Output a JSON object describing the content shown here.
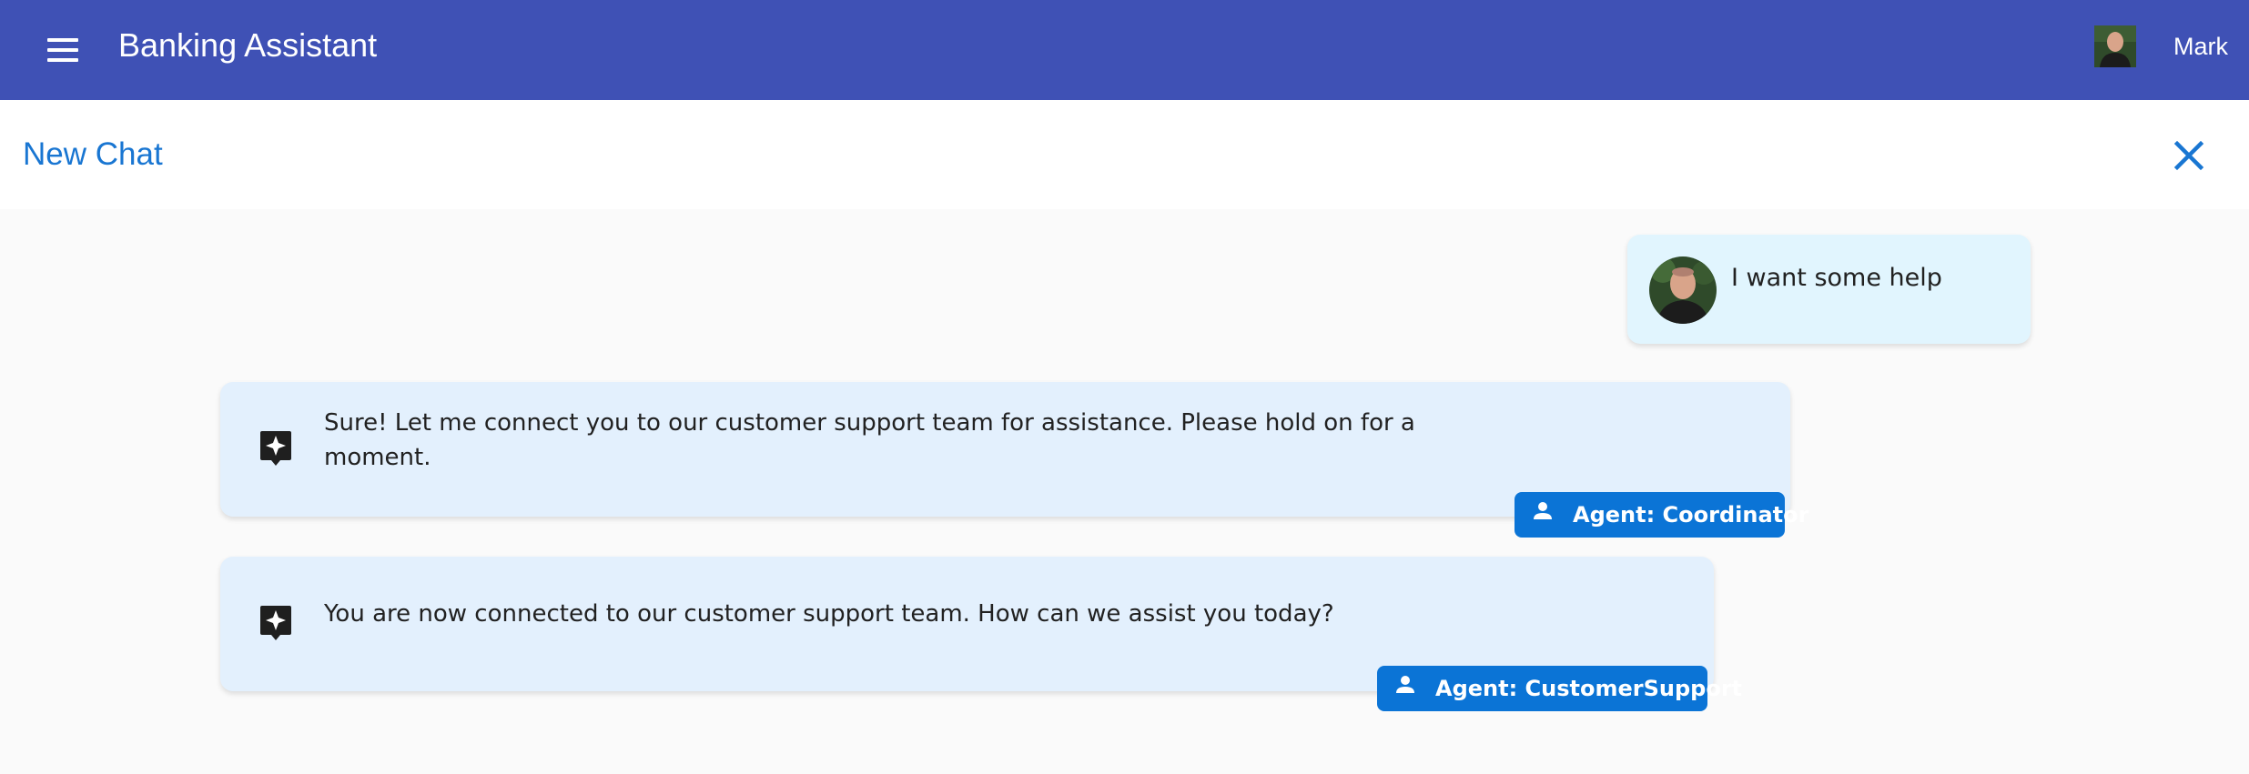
{
  "app": {
    "title": "Banking Assistant",
    "user_name": "Mark",
    "theme": {
      "primary": "#3f51b5",
      "accent": "#1976d2",
      "badge": "#0b74d6",
      "user_bubble": "#e1f5fe",
      "bot_bubble": "#e3f0fd"
    }
  },
  "icons": {
    "menu": "menu-icon",
    "close": "close-icon",
    "bot": "sparkle-chat-icon",
    "agent": "person-icon"
  },
  "chat": {
    "title": "New Chat",
    "messages": [
      {
        "role": "user",
        "text": "I want some help"
      },
      {
        "role": "assistant",
        "text": "Sure! Let me connect you to our customer support team for assistance. Please hold on for a moment.",
        "agent_label": "Agent: Coordinator"
      },
      {
        "role": "assistant",
        "text": "You are now connected to our customer support team. How can we assist you today?",
        "agent_label": "Agent: CustomerSupport"
      }
    ]
  }
}
